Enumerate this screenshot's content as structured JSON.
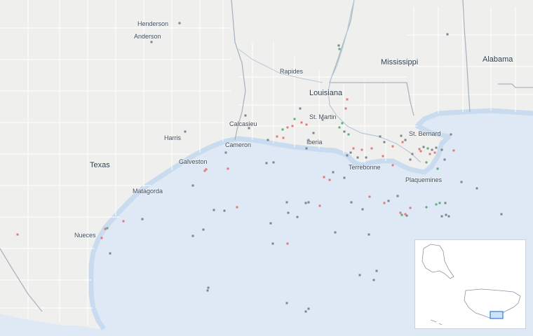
{
  "map": {
    "colors": {
      "land": "#eff0ee",
      "water": "#dfe9f5",
      "county_border": "#ffffff",
      "state_border": "#a9b4bf",
      "coast_band": "#c9dbef",
      "marker_red": "#e07b7b",
      "marker_green": "#5fae7a",
      "marker_gray": "#7c858e",
      "inset_highlight": "#2f7fd6"
    },
    "states": {
      "louisiana": "Louisiana",
      "mississippi": "Mississippi",
      "alabama": "Alabama",
      "texas": "Texas"
    },
    "counties": {
      "henderson": "Henderson",
      "anderson": "Anderson",
      "rapides": "Rapides",
      "st_martin": "St. Martin",
      "calcasieu": "Calcasieu",
      "harris": "Harris",
      "cameron": "Cameron",
      "iberia": "Iberia",
      "st_bernard": "St. Bernard",
      "galveston": "Galveston",
      "terrebonne": "Terrebonne",
      "plaquemines": "Plaquemines",
      "matagorda": "Matagorda",
      "nueces": "Nueces"
    },
    "marker_types": [
      "red-square-marker",
      "green-square-marker",
      "gray-square-marker"
    ],
    "inset": {
      "icon": "us-overview-inset"
    }
  }
}
